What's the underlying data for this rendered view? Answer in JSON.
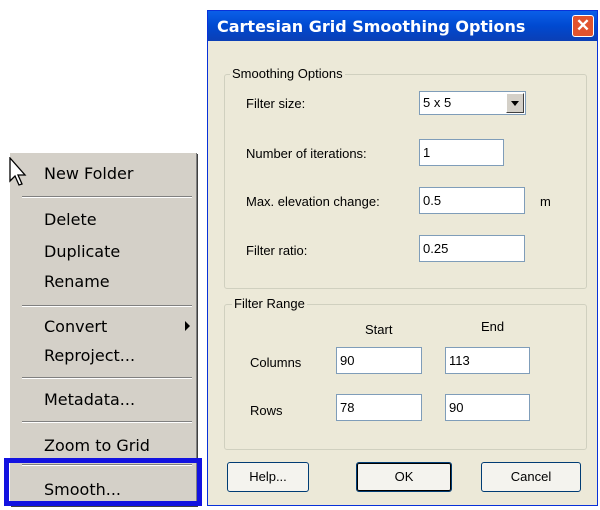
{
  "context_menu": {
    "items": [
      {
        "label": "New Folder"
      },
      {
        "label": "Delete"
      },
      {
        "label": "Duplicate"
      },
      {
        "label": "Rename"
      },
      {
        "label": "Convert"
      },
      {
        "label": "Reproject..."
      },
      {
        "label": "Metadata..."
      },
      {
        "label": "Zoom to Grid"
      },
      {
        "label": "Smooth..."
      }
    ],
    "highlight_color": "#1212e0"
  },
  "dialog": {
    "title": "Cartesian Grid Smoothing Options",
    "smoothing_options": {
      "group_label": "Smoothing Options",
      "filter_size_label": "Filter size:",
      "filter_size_value": "5 x 5",
      "iterations_label": "Number of iterations:",
      "iterations_value": "1",
      "max_elev_label": "Max. elevation change:",
      "max_elev_value": "0.5",
      "max_elev_unit": "m",
      "filter_ratio_label": "Filter ratio:",
      "filter_ratio_value": "0.25"
    },
    "filter_range": {
      "group_label": "Filter Range",
      "start_header": "Start",
      "end_header": "End",
      "columns_label": "Columns",
      "columns_start": "90",
      "columns_end": "113",
      "rows_label": "Rows",
      "rows_start": "78",
      "rows_end": "90"
    },
    "buttons": {
      "help": "Help...",
      "ok": "OK",
      "cancel": "Cancel"
    },
    "colors": {
      "titlebar": "#0049d0",
      "close": "#e1532e",
      "face": "#ece9d8"
    }
  }
}
